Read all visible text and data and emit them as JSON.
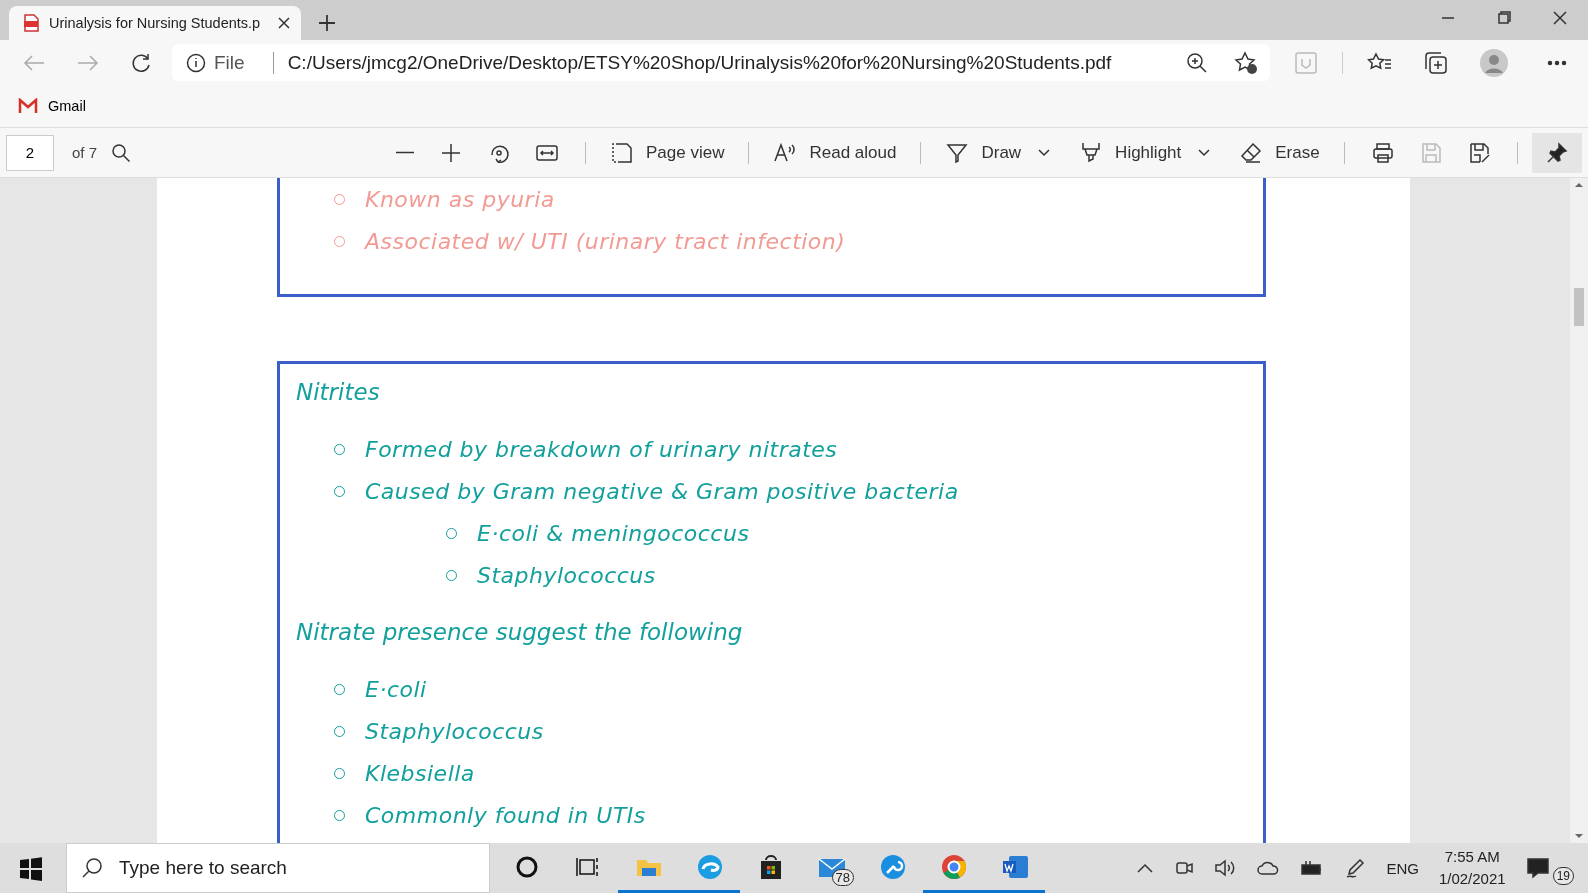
{
  "tabs": [
    {
      "title": "Urinalysis for Nursing Students.p",
      "selected": true
    }
  ],
  "address_bar": {
    "scheme": "File",
    "url": "C:/Users/jmcg2/OneDrive/Desktop/ETSY%20Shop/Urinalysis%20for%20Nursing%20Students.pdf"
  },
  "bookmarks": [
    {
      "label": "Gmail"
    }
  ],
  "pdf_toolbar": {
    "page_number": "2",
    "page_count": "of 7",
    "page_view": "Page view",
    "read_aloud": "Read aloud",
    "draw": "Draw",
    "highlight": "Highlight",
    "erase": "Erase",
    "save_disabled": true,
    "pinned": true
  },
  "document": {
    "sections": [
      {
        "color": "#f29a94",
        "groups": [
          {
            "items": [
              {
                "text": "Known as pyuria"
              },
              {
                "text": "Associated w/ UTI (urinary tract infection)"
              }
            ]
          }
        ]
      },
      {
        "color": "#12a09c",
        "groups": [
          {
            "heading": "Nitrites",
            "items": [
              {
                "text": "Formed by breakdown of urinary nitrates"
              },
              {
                "text": "Caused by Gram negative & Gram positive bacteria",
                "children": [
                  {
                    "text": "E·coli & meningococcus"
                  },
                  {
                    "text": "Staphylococcus"
                  }
                ]
              }
            ]
          },
          {
            "heading": "Nitrate presence suggest the following",
            "items": [
              {
                "text": "E·coli"
              },
              {
                "text": "Staphylococcus"
              },
              {
                "text": "Klebsiella"
              },
              {
                "text": "Commonly found in UTIs"
              }
            ]
          }
        ]
      }
    ]
  },
  "taskbar": {
    "search_placeholder": "Type here to search",
    "apps": [
      {
        "kind": "cortana",
        "running": false
      },
      {
        "kind": "taskview",
        "running": false
      },
      {
        "kind": "explorer",
        "running": true
      },
      {
        "kind": "edge",
        "running": true
      },
      {
        "kind": "store",
        "running": false
      },
      {
        "kind": "mail",
        "running": false,
        "badge": "78"
      },
      {
        "kind": "wrench",
        "running": false
      },
      {
        "kind": "chrome",
        "running": true
      },
      {
        "kind": "word",
        "running": true
      }
    ],
    "language": "ENG",
    "time": "7:55 AM",
    "date": "1/02/2021",
    "notifications": "19"
  }
}
